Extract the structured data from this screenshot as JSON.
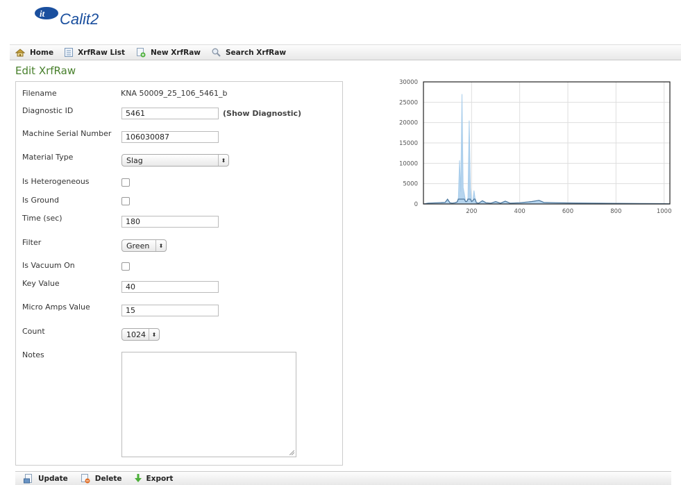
{
  "app": {
    "logo_text": "Calit2",
    "logo_badge": "it"
  },
  "nav": {
    "home": "Home",
    "list": "XrfRaw List",
    "new": "New XrfRaw",
    "search": "Search XrfRaw"
  },
  "page_title": "Edit XrfRaw",
  "form": {
    "filename_label": "Filename",
    "filename_value": "KNA 50009_25_106_5461_b",
    "diagnostic_label": "Diagnostic ID",
    "diagnostic_value": "5461",
    "show_diagnostic": "(Show Diagnostic)",
    "serial_label": "Machine Serial Number",
    "serial_value": "106030087",
    "material_label": "Material Type",
    "material_value": "Slag",
    "hetero_label": "Is Heterogeneous",
    "hetero_checked": false,
    "ground_label": "Is Ground",
    "ground_checked": false,
    "time_label": "Time (sec)",
    "time_value": "180",
    "filter_label": "Filter",
    "filter_value": "Green",
    "vacuum_label": "Is Vacuum On",
    "vacuum_checked": false,
    "key_label": "Key Value",
    "key_value": "40",
    "micro_label": "Micro Amps Value",
    "micro_value": "15",
    "count_label": "Count",
    "count_value": "1024",
    "notes_label": "Notes",
    "notes_value": ""
  },
  "footer": {
    "update": "Update",
    "delete": "Delete",
    "export": "Export"
  },
  "colors": {
    "title_green": "#48802c",
    "series_blue": "#a8cdeb",
    "series_line": "#1f4e79"
  },
  "chart_data": {
    "type": "line",
    "title": "",
    "xlabel": "",
    "ylabel": "",
    "xlim": [
      0,
      1024
    ],
    "ylim": [
      0,
      30000
    ],
    "xticks": [
      "200",
      "400",
      "600",
      "800",
      "1000"
    ],
    "yticks": [
      "0",
      "5000",
      "10000",
      "15000",
      "20000",
      "25000",
      "30000"
    ],
    "grid": true,
    "series": [
      {
        "x": [
          0,
          20,
          60,
          90,
          100,
          110,
          120,
          130,
          140,
          145,
          150,
          155,
          160,
          165,
          170,
          175,
          180,
          185,
          190,
          195,
          200,
          205,
          210,
          215,
          220,
          230,
          245,
          260,
          280,
          300,
          320,
          340,
          360,
          400,
          450,
          480,
          500,
          550,
          600,
          700,
          800,
          900,
          1000,
          1024
        ],
        "y": [
          0,
          200,
          300,
          400,
          1200,
          300,
          200,
          300,
          500,
          1500,
          10700,
          3000,
          27000,
          4000,
          2500,
          600,
          600,
          1500,
          20500,
          4000,
          600,
          800,
          3300,
          1200,
          300,
          200,
          800,
          300,
          200,
          600,
          200,
          700,
          200,
          300,
          600,
          900,
          400,
          300,
          250,
          200,
          150,
          100,
          80,
          50
        ]
      }
    ]
  }
}
